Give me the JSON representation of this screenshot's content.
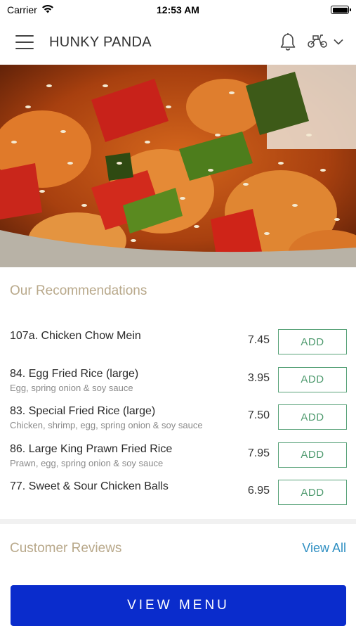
{
  "status_bar": {
    "carrier": "Carrier",
    "time": "12:53 AM"
  },
  "header": {
    "title": "HUNKY PANDA",
    "icons": [
      "menu-icon",
      "bell-icon",
      "scooter-icon",
      "chevron-down-icon"
    ]
  },
  "hero": {
    "icon": "food-photo"
  },
  "recommendations": {
    "title": "Our Recommendations",
    "items": [
      {
        "name": "107a. Chicken Chow Mein",
        "description": "",
        "price": "7.45",
        "button": "ADD"
      },
      {
        "name": "84. Egg Fried Rice (large)",
        "description": "Egg, spring onion & soy sauce",
        "price": "3.95",
        "button": "ADD"
      },
      {
        "name": "83. Special Fried Rice (large)",
        "description": "Chicken, shrimp, egg, spring onion & soy sauce",
        "price": "7.50",
        "button": "ADD"
      },
      {
        "name": "86. Large King Prawn Fried Rice",
        "description": "Prawn, egg, spring onion & soy sauce",
        "price": "7.95",
        "button": "ADD"
      },
      {
        "name": "77. Sweet & Sour Chicken Balls",
        "description": "",
        "price": "6.95",
        "button": "ADD"
      }
    ]
  },
  "reviews": {
    "title": "Customer Reviews",
    "view_all": "View All"
  },
  "cta": {
    "label": "VIEW MENU"
  },
  "colors": {
    "primary": "#0a2ccc",
    "add_green": "#4e9a6e",
    "section_title": "#b8a88a",
    "link": "#2f8fc2"
  }
}
